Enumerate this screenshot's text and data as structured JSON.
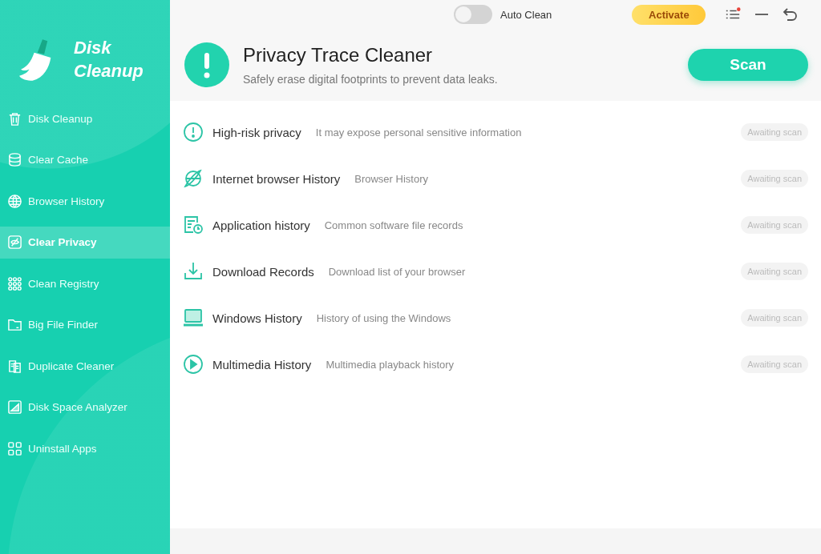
{
  "app": {
    "name_line_1": "Disk",
    "name_line_2": "Cleanup"
  },
  "sidebar": {
    "items": [
      {
        "label": "Disk Cleanup",
        "kind": "trash",
        "selected": false
      },
      {
        "label": "Clear Cache",
        "kind": "database",
        "selected": false
      },
      {
        "label": "Browser History",
        "kind": "globe",
        "selected": false
      },
      {
        "label": "Clear Privacy",
        "kind": "privacy",
        "selected": true
      },
      {
        "label": "Clean Registry",
        "kind": "registry",
        "selected": false
      },
      {
        "label": "Big File Finder",
        "kind": "folder",
        "selected": false
      },
      {
        "label": "Duplicate Cleaner",
        "kind": "duplicate",
        "selected": false
      },
      {
        "label": "Disk Space Analyzer",
        "kind": "analyzer",
        "selected": false
      },
      {
        "label": "Uninstall Apps",
        "kind": "apps",
        "selected": false
      }
    ]
  },
  "top_bar": {
    "auto_clean": {
      "label": "Auto Clean",
      "on": false
    },
    "activate": "Activate",
    "menu_badge": true
  },
  "header": {
    "title": "Privacy Trace Cleaner",
    "subtitle": "Safely erase digital footprints to prevent data leaks.",
    "scan": "Scan"
  },
  "categories": [
    {
      "kind": "alert",
      "name": "High-risk privacy",
      "description": "It may expose personal sensitive information",
      "status": "Awaiting scan"
    },
    {
      "kind": "browser",
      "name": "Internet browser History",
      "description": "Browser History",
      "status": "Awaiting scan"
    },
    {
      "kind": "app",
      "name": "Application history",
      "description": "Common software file records",
      "status": "Awaiting scan"
    },
    {
      "kind": "download",
      "name": "Download Records",
      "description": "Download list of your browser",
      "status": "Awaiting scan"
    },
    {
      "kind": "laptop",
      "name": "Windows History",
      "description": "History of using the Windows",
      "status": "Awaiting scan"
    },
    {
      "kind": "play",
      "name": "Multimedia History",
      "description": "Multimedia playback history",
      "status": "Awaiting scan"
    }
  ]
}
